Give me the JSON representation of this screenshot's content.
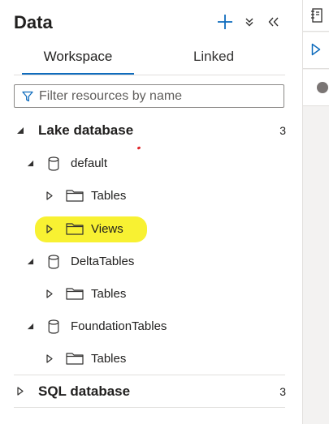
{
  "header": {
    "title": "Data"
  },
  "tabs": [
    {
      "label": "Workspace",
      "active": true
    },
    {
      "label": "Linked",
      "active": false
    }
  ],
  "filter": {
    "placeholder": "Filter resources by name",
    "value": ""
  },
  "tree": {
    "lake_database": {
      "label": "Lake database",
      "count": "3",
      "expanded": true
    },
    "default": {
      "label": "default",
      "tables": "Tables",
      "views": "Views"
    },
    "delta": {
      "label": "DeltaTables",
      "tables": "Tables"
    },
    "foundation": {
      "label": "FoundationTables",
      "tables": "Tables"
    },
    "sql_database": {
      "label": "SQL database",
      "count": "3",
      "expanded": false
    }
  },
  "colors": {
    "accent": "#0f6cbd",
    "highlight": "#f8f027",
    "separator": "#e1dfdd"
  }
}
